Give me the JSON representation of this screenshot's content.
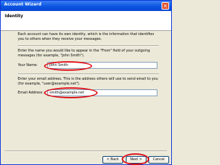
{
  "window": {
    "title": "Account Wizard"
  },
  "header": {
    "title": "Identity"
  },
  "intro": "Each account can have its own identity, which is the information that identifies you to others when they receive your messages.",
  "name_section": {
    "instructions": "Enter the name you would like to appear in the \"From\" field of your outgoing messages (for example, \"John Smith\").",
    "label": "Your Name:",
    "value": "John Smith"
  },
  "email_section": {
    "instructions": "Enter your email address. This is the address others will use to send email to you (for example, \"user@example.net\").",
    "label": "Email Address:",
    "value": "smith@example.net"
  },
  "buttons": {
    "back": "< Back",
    "next": "Next >",
    "cancel": "Cancel"
  },
  "colors": {
    "annotation": "#e0101a",
    "title_bar": "#0a53e0"
  }
}
